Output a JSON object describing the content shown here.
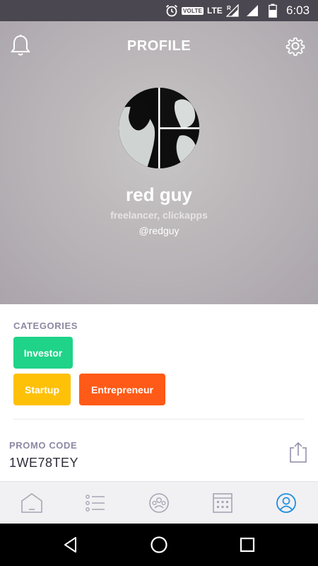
{
  "status_bar": {
    "volte": "VOLTE",
    "network": "LTE",
    "roaming": "R",
    "battery_label": "56",
    "time": "6:03"
  },
  "header": {
    "title": "PROFILE"
  },
  "profile": {
    "name": "red guy",
    "role": "freelancer, clickapps",
    "handle": "@redguy"
  },
  "categories": {
    "label": "CATEGORIES",
    "items": [
      {
        "label": "Investor",
        "color": "#1fd388"
      },
      {
        "label": "Startup",
        "color": "#ffc107"
      },
      {
        "label": "Entrepreneur",
        "color": "#ff5a17"
      }
    ]
  },
  "promo": {
    "label": "PROMO CODE",
    "code": "1WE78TEY"
  },
  "tabbar": {
    "tabs": [
      {
        "icon": "home-icon",
        "active": false
      },
      {
        "icon": "list-icon",
        "active": false
      },
      {
        "icon": "people-icon",
        "active": false
      },
      {
        "icon": "calendar-icon",
        "active": false
      },
      {
        "icon": "profile-icon",
        "active": true
      }
    ],
    "active_color": "#1c8fe0",
    "inactive_color": "#a7a5b6"
  },
  "colors": {
    "status_bar": "#4b4750",
    "accent_label": "#8d88a3"
  }
}
